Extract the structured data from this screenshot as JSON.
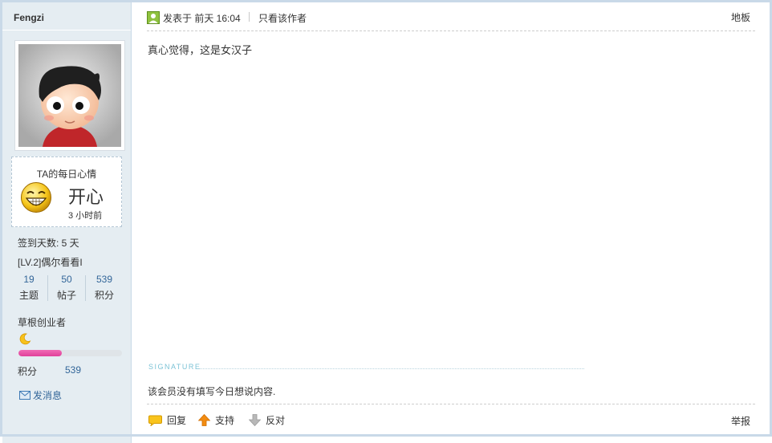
{
  "author": {
    "name": "Fengzi",
    "mood": {
      "title": "TA的每日心情",
      "text": "开心",
      "time": "3 小时前"
    },
    "checkin": "签到天数: 5 天",
    "level": "[LV.2]偶尔看看I",
    "stats": [
      {
        "value": "19",
        "label": "主题"
      },
      {
        "value": "50",
        "label": "帖子"
      },
      {
        "value": "539",
        "label": "积分"
      }
    ],
    "rank": "草根创业者",
    "rank_progress_percent": 42,
    "points_label": "积分",
    "points_value": "539",
    "send_message": "发消息"
  },
  "post": {
    "posted": "发表于 前天 16:04",
    "author_only": "只看该作者",
    "floor": "地板",
    "content": "真心觉得，这是女汉子",
    "signature_label": "SIGNATURE",
    "signature_text": "该会员没有填写今日想说内容."
  },
  "actions": {
    "reply": "回复",
    "support": "支持",
    "oppose": "反对",
    "report": "举报"
  },
  "colors": {
    "sidebar_bg": "#e5edf2",
    "link": "#336699",
    "progress": "#e0409a"
  }
}
